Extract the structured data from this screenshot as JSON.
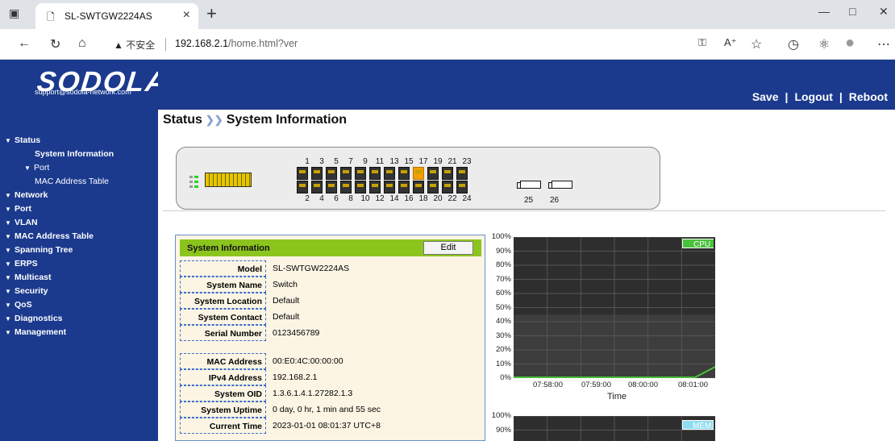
{
  "browser": {
    "tab_title": "SL-SWTGW2224AS",
    "security_warning": "不安全",
    "url_host": "192.168.2.1",
    "url_path": "/home.html?ver"
  },
  "brand": {
    "logo_text": "SODOLA",
    "support_email": "support@sodola-network.com"
  },
  "header": {
    "save_label": "Save",
    "logout_label": "Logout",
    "reboot_label": "Reboot"
  },
  "breadcrumb": {
    "section": "Status",
    "page": "System Information"
  },
  "sidebar": {
    "items": [
      {
        "label": "Status",
        "level": 0
      },
      {
        "label": "System Information",
        "level": 1
      },
      {
        "label": "Port",
        "level": 2
      },
      {
        "label": "MAC Address Table",
        "level": 3
      },
      {
        "label": "Network",
        "level": 0
      },
      {
        "label": "Port",
        "level": 0
      },
      {
        "label": "VLAN",
        "level": 0
      },
      {
        "label": "MAC Address Table",
        "level": 0
      },
      {
        "label": "Spanning Tree",
        "level": 0
      },
      {
        "label": "ERPS",
        "level": 0
      },
      {
        "label": "Multicast",
        "level": 0
      },
      {
        "label": "Security",
        "level": 0
      },
      {
        "label": "QoS",
        "level": 0
      },
      {
        "label": "Diagnostics",
        "level": 0
      },
      {
        "label": "Management",
        "level": 0
      }
    ]
  },
  "switch_panel": {
    "top_ports": [
      "1",
      "3",
      "5",
      "7",
      "9",
      "11",
      "13",
      "15",
      "17",
      "19",
      "21",
      "23"
    ],
    "bottom_ports": [
      "2",
      "4",
      "6",
      "8",
      "10",
      "12",
      "14",
      "16",
      "18",
      "20",
      "22",
      "24"
    ],
    "sfp_ports": [
      "25",
      "26"
    ],
    "active_port": "17"
  },
  "system_info": {
    "title": "System Information",
    "edit_label": "Edit",
    "rows": [
      {
        "label": "Model",
        "value": "SL-SWTGW2224AS"
      },
      {
        "label": "System Name",
        "value": "Switch"
      },
      {
        "label": "System Location",
        "value": "Default"
      },
      {
        "label": "System Contact",
        "value": "Default"
      },
      {
        "label": "Serial Number",
        "value": "0123456789"
      },
      {
        "label": "MAC Address",
        "value": "00:E0:4C:00:00:00"
      },
      {
        "label": "IPv4 Address",
        "value": "192.168.2.1"
      },
      {
        "label": "System OID",
        "value": "1.3.6.1.4.1.27282.1.3"
      },
      {
        "label": "System Uptime",
        "value": "0 day, 0 hr, 1 min and 55 sec"
      },
      {
        "label": "Current Time",
        "value": "2023-01-01 08:01:37 UTC+8"
      }
    ]
  },
  "chart_data": [
    {
      "type": "area",
      "legend": "CPU",
      "xlabel": "Time",
      "y_ticks": [
        "100%",
        "90%",
        "80%",
        "70%",
        "60%",
        "50%",
        "40%",
        "30%",
        "20%",
        "10%",
        "0%"
      ],
      "x_ticks": [
        "07:58:00",
        "07:59:00",
        "08:00:00",
        "08:01:00"
      ],
      "ylim": [
        0,
        100
      ],
      "x": [
        "07:57:00",
        "07:58:00",
        "07:59:00",
        "08:00:00",
        "08:01:00",
        "08:01:37"
      ],
      "values": [
        0,
        0,
        0,
        0,
        0,
        8
      ],
      "colors": {
        "bg": "#2e2e2e",
        "line": "#49c13a",
        "legend": "#49c13a"
      }
    },
    {
      "type": "area",
      "legend": "MEM",
      "y_ticks": [
        "100%",
        "90%"
      ],
      "ylim": [
        0,
        100
      ],
      "colors": {
        "bg": "#2e2e2e",
        "legend": "#8fdcf0"
      }
    }
  ]
}
